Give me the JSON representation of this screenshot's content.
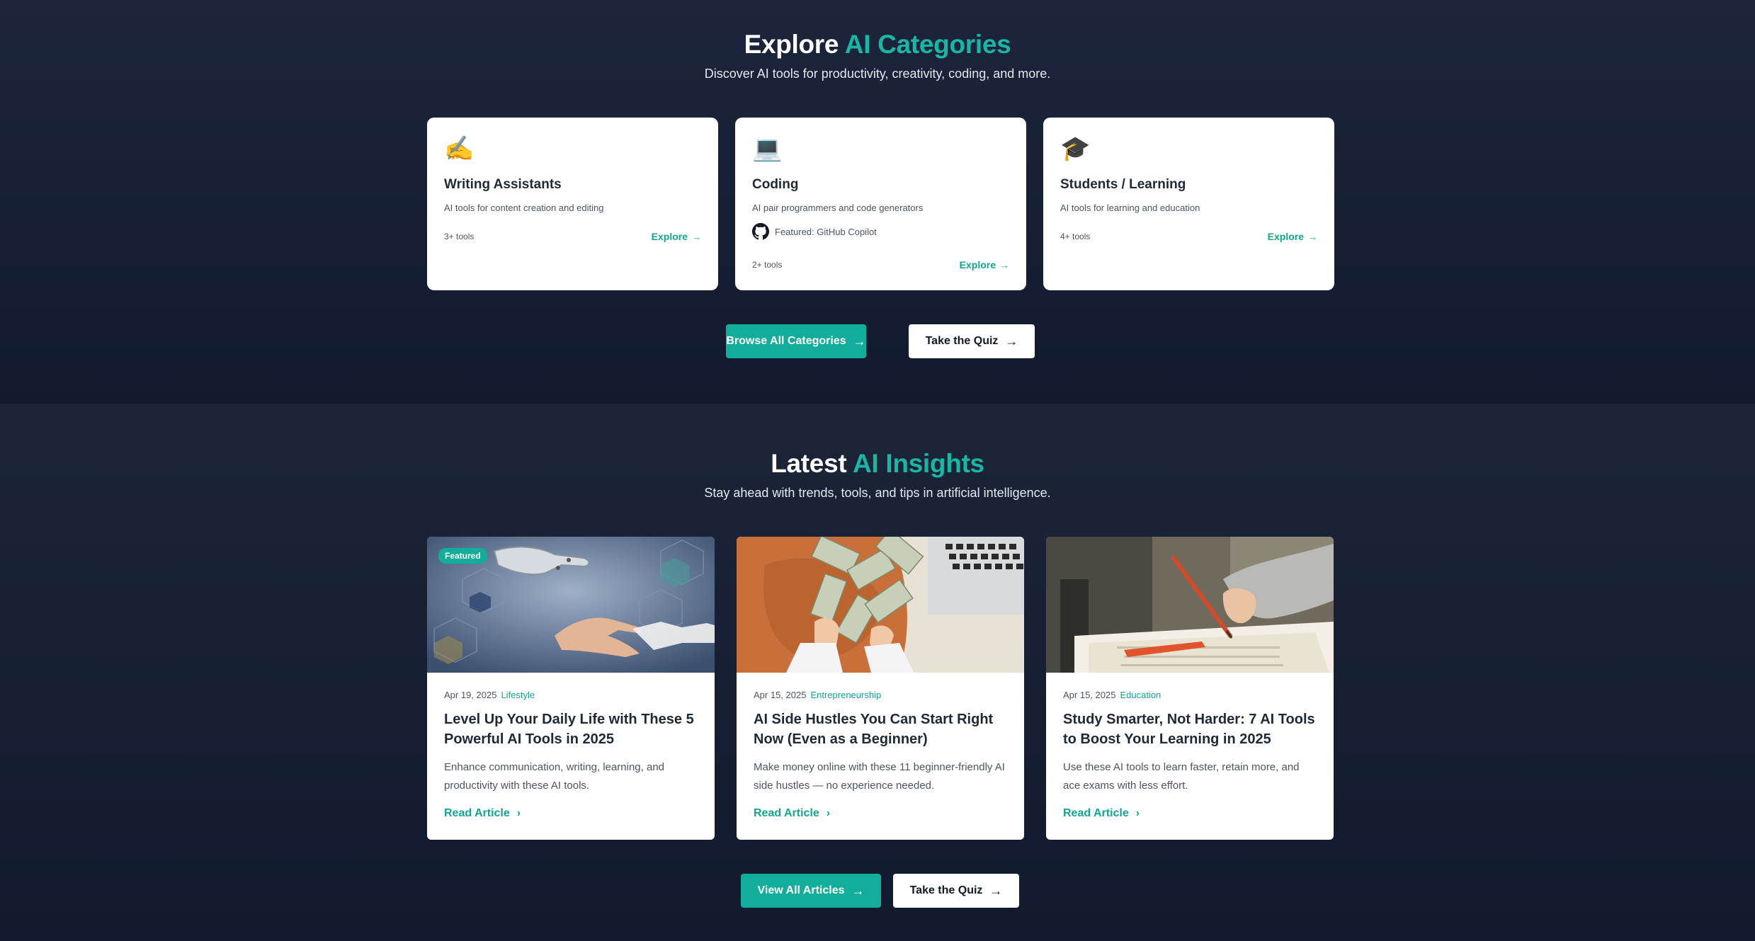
{
  "categories": {
    "title_main": "Explore",
    "title_accent": "AI Categories",
    "subtitle": "Discover AI tools for productivity, creativity, coding, and more.",
    "cards": [
      {
        "icon": "✍️",
        "icon_name": "writing-hand-icon",
        "title": "Writing Assistants",
        "description": "AI tools for content creation and editing",
        "count": "3+ tools",
        "explore": "Explore"
      },
      {
        "icon": "💻",
        "icon_name": "laptop-icon",
        "title": "Coding",
        "description": "AI pair programmers and code generators",
        "featured": "Featured: GitHub Copilot",
        "featured_icon": "github-icon",
        "count": "2+ tools",
        "explore": "Explore"
      },
      {
        "icon": "🎓",
        "icon_name": "graduation-cap-icon",
        "title": "Students / Learning",
        "description": "AI tools for learning and education",
        "count": "4+ tools",
        "explore": "Explore"
      }
    ],
    "browse_button": "Browse All Categories",
    "quiz_button": "Take the Quiz"
  },
  "insights": {
    "title_main": "Latest",
    "title_accent": "AI Insights",
    "subtitle": "Stay ahead with trends, tools, and tips in artificial intelligence.",
    "articles": [
      {
        "badge": "Featured",
        "date": "Apr 19, 2025",
        "category": "Lifestyle",
        "title": "Level Up Your Daily Life with These 5 Powerful AI Tools in 2025",
        "excerpt": "Enhance communication, writing, learning, and productivity with these AI tools.",
        "read": "Read Article"
      },
      {
        "date": "Apr 15, 2025",
        "category": "Entrepreneurship",
        "title": "AI Side Hustles You Can Start Right Now (Even as a Beginner)",
        "excerpt": "Make money online with these 11 beginner-friendly AI side hustles — no experience needed.",
        "read": "Read Article"
      },
      {
        "date": "Apr 15, 2025",
        "category": "Education",
        "title": "Study Smarter, Not Harder: 7 AI Tools to Boost Your Learning in 2025",
        "excerpt": "Use these AI tools to learn faster, retain more, and ace exams with less effort.",
        "read": "Read Article"
      }
    ],
    "view_button": "View All Articles",
    "quiz_button": "Take the Quiz"
  },
  "colors": {
    "accent": "#19b6a4",
    "button": "#12ad9b",
    "background": "#111a2e"
  }
}
